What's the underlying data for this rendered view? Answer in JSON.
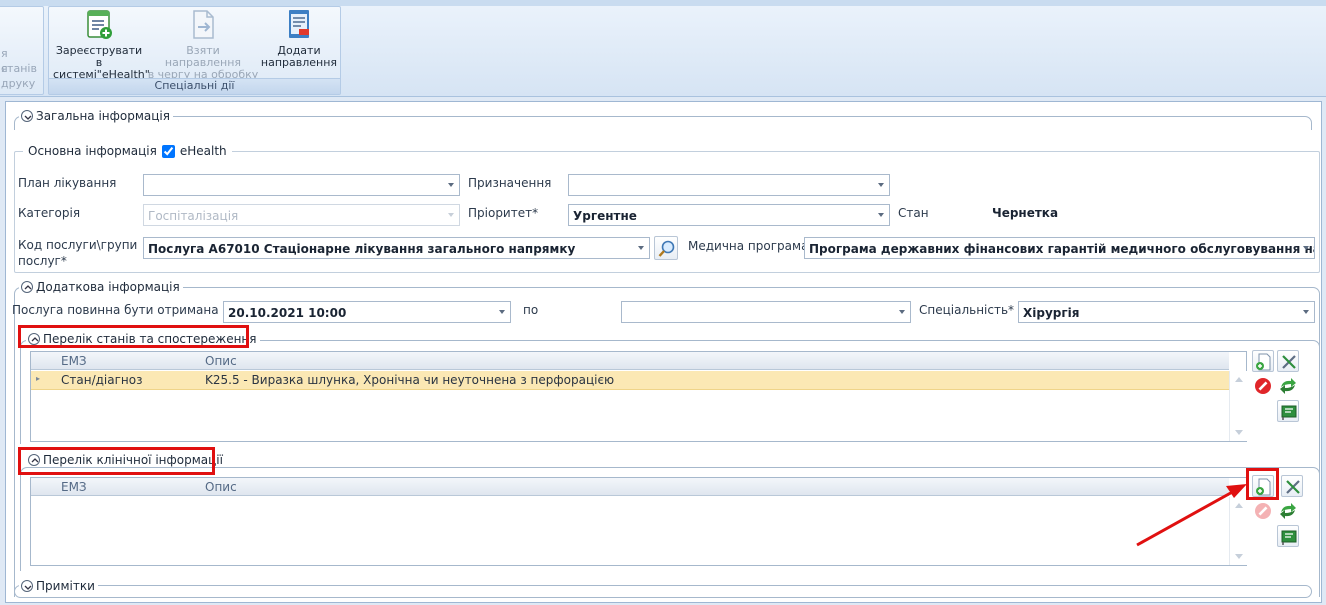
{
  "ribbon": {
    "left_partial_lines": [
      "я станів",
      "я друку"
    ],
    "buttons": [
      {
        "label_lines": [
          "Зареєструвати в",
          "системі\"eHealth\""
        ],
        "icon": "register-ehealth-icon",
        "enabled": true
      },
      {
        "label_lines": [
          "Взяти направлення",
          "в чергу на обробку"
        ],
        "icon": "queue-referral-icon",
        "enabled": false
      },
      {
        "label_lines": [
          "Додати",
          "направлення"
        ],
        "icon": "add-referral-icon",
        "enabled": true
      }
    ],
    "group_caption": "Спеціальні дії"
  },
  "general": {
    "title": "Загальна інформація",
    "basic": {
      "title": "Основна інформація",
      "ehealth_label": "eHealth",
      "ehealth_checked": true,
      "plan_label": "План лікування",
      "plan_value": "",
      "purpose_label": "Призначення",
      "purpose_value": "",
      "category_label": "Категорія",
      "category_value": "Госпіталізація",
      "priority_label": "Пріоритет*",
      "priority_value": "Ургентне",
      "state_label": "Стан",
      "state_value": "Чернетка",
      "service_label_lines": [
        "Код послуги\\групи",
        "послуг*"
      ],
      "service_value": "Послуга А67010 Стаціонарне лікування загального напрямку",
      "program_label": "Медична програма",
      "program_value": "Програма державних фінансових гарантій медичного обслуговування населення"
    }
  },
  "additional": {
    "title": "Додаткова інформація",
    "from_label": "Послуга повинна бути отримана з",
    "from_value": "20.10.2021 10:00",
    "to_label": "по",
    "to_value": "",
    "specialty_label": "Спеціальність*",
    "specialty_value": "Хірургія"
  },
  "conditions": {
    "title": "Перелік станів та спостереження",
    "columns": [
      "ЕМЗ",
      "Опис"
    ],
    "rows": [
      {
        "emz": "Стан/діагноз",
        "desc": "K25.5 - Виразка шлунка, Хронічна чи неуточнена з перфорацією"
      }
    ]
  },
  "clinical": {
    "title": "Перелік клінічної інформації",
    "columns": [
      "ЕМЗ",
      "Опис"
    ],
    "rows": []
  },
  "notes": {
    "title": "Примітки"
  },
  "colors": {
    "highlight": "#e01010",
    "selected_row": "#fbe8b4"
  }
}
